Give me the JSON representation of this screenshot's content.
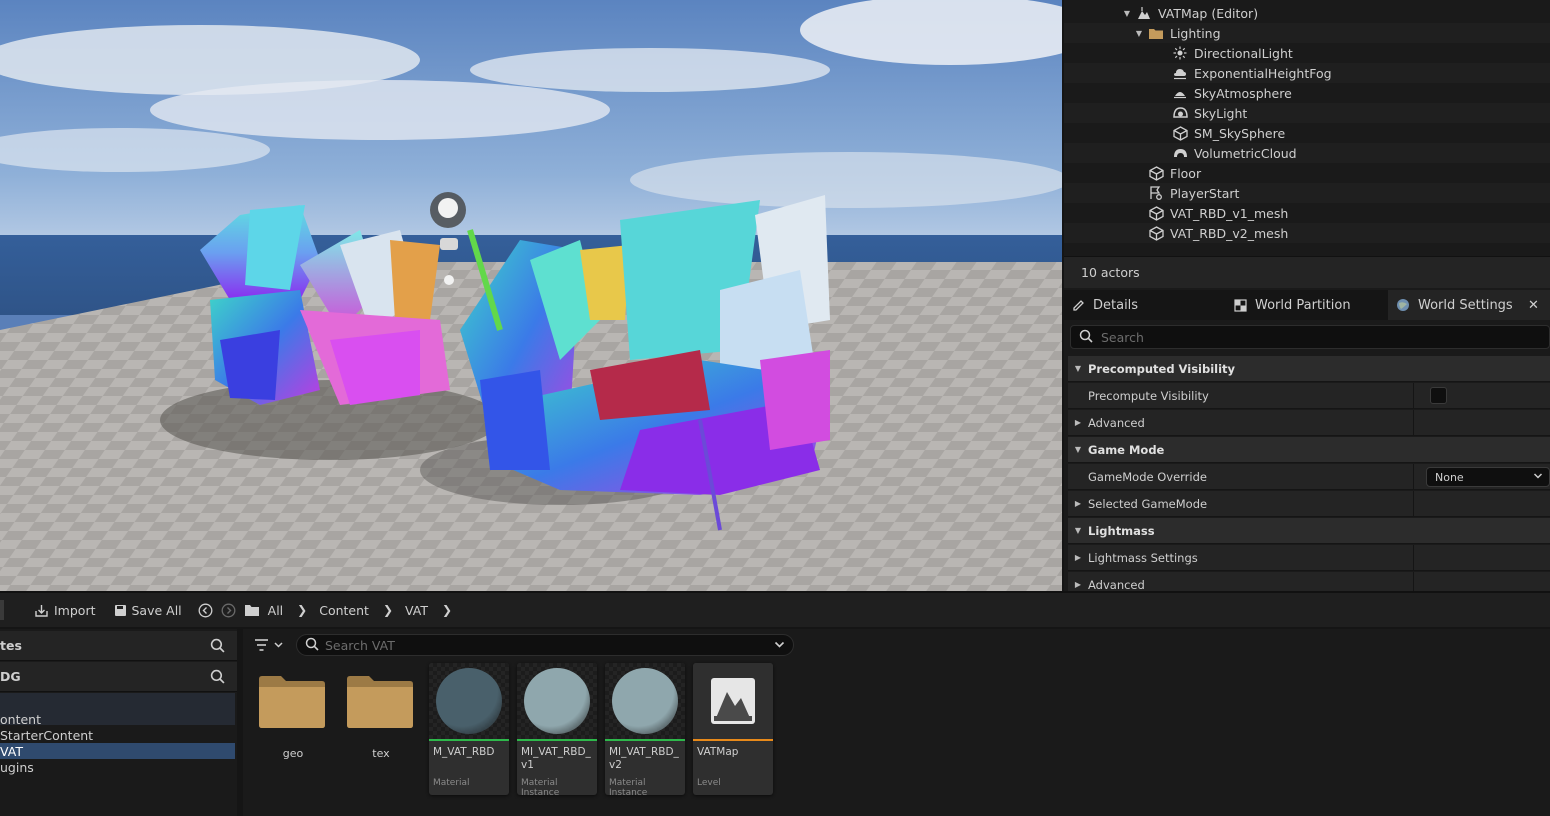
{
  "outliner": {
    "items": [
      {
        "label": "VATMap (Editor)",
        "icon": "level-icon",
        "indent": 0,
        "expanded": true
      },
      {
        "label": "Lighting",
        "icon": "folder-icon",
        "indent": 1,
        "expanded": true
      },
      {
        "label": "DirectionalLight",
        "icon": "directional-light-icon",
        "indent": 2
      },
      {
        "label": "ExponentialHeightFog",
        "icon": "fog-icon",
        "indent": 2
      },
      {
        "label": "SkyAtmosphere",
        "icon": "sky-atmosphere-icon",
        "indent": 2
      },
      {
        "label": "SkyLight",
        "icon": "sky-light-icon",
        "indent": 2
      },
      {
        "label": "SM_SkySphere",
        "icon": "static-mesh-icon",
        "indent": 2
      },
      {
        "label": "VolumetricCloud",
        "icon": "cloud-icon",
        "indent": 2
      },
      {
        "label": "Floor",
        "icon": "static-mesh-icon",
        "indent": 1
      },
      {
        "label": "PlayerStart",
        "icon": "player-start-icon",
        "indent": 1
      },
      {
        "label": "VAT_RBD_v1_mesh",
        "icon": "static-mesh-icon",
        "indent": 1
      },
      {
        "label": "VAT_RBD_v2_mesh",
        "icon": "static-mesh-icon",
        "indent": 1
      }
    ],
    "actor_count": "10 actors"
  },
  "tabs": [
    {
      "label": "Details",
      "icon": "pencil-icon"
    },
    {
      "label": "World Partition",
      "icon": "grid-icon"
    },
    {
      "label": "World Settings",
      "icon": "globe-icon",
      "active": true
    }
  ],
  "details": {
    "search_placeholder": "Search",
    "rows": [
      {
        "type": "section",
        "label": "Precomputed Visibility"
      },
      {
        "type": "item",
        "label": "Precompute Visibility",
        "control": "checkbox"
      },
      {
        "type": "item",
        "label": "Advanced",
        "expandable": true
      },
      {
        "type": "section",
        "label": "Game Mode"
      },
      {
        "type": "item",
        "label": "GameMode Override",
        "control": "combo",
        "value": "None"
      },
      {
        "type": "item",
        "label": "Selected GameMode",
        "expandable": true
      },
      {
        "type": "section",
        "label": "Lightmass"
      },
      {
        "type": "item",
        "label": "Lightmass Settings",
        "expandable": true
      },
      {
        "type": "item",
        "label": "Advanced",
        "expandable": true
      }
    ]
  },
  "toolbar": {
    "import_label": "Import",
    "save_all_label": "Save All",
    "breadcrumbs": [
      "All",
      "Content",
      "VAT"
    ]
  },
  "sources": {
    "favorites_label": "tes",
    "project_label": "DG",
    "tree": [
      {
        "label": "ontent"
      },
      {
        "label": "StarterContent"
      },
      {
        "label": "VAT",
        "selected": true
      },
      {
        "label": "ugins"
      }
    ]
  },
  "content": {
    "search_placeholder": "Search VAT",
    "folders": [
      "geo",
      "tex"
    ],
    "assets": [
      {
        "name": "M_VAT_RBD",
        "type": "Material",
        "bar_color": "#2eb84b",
        "sphere_color": "#49606b"
      },
      {
        "name": "MI_VAT_RBD_v1",
        "type": "Material Instance",
        "bar_color": "#2eb84b",
        "sphere_color": "#8fa7ad"
      },
      {
        "name": "MI_VAT_RBD_v2",
        "type": "Material Instance",
        "bar_color": "#2eb84b",
        "sphere_color": "#8fa7ad"
      },
      {
        "name": "VATMap",
        "type": "Level",
        "bar_color": "#e88a1a",
        "icon": "level-icon"
      }
    ]
  }
}
